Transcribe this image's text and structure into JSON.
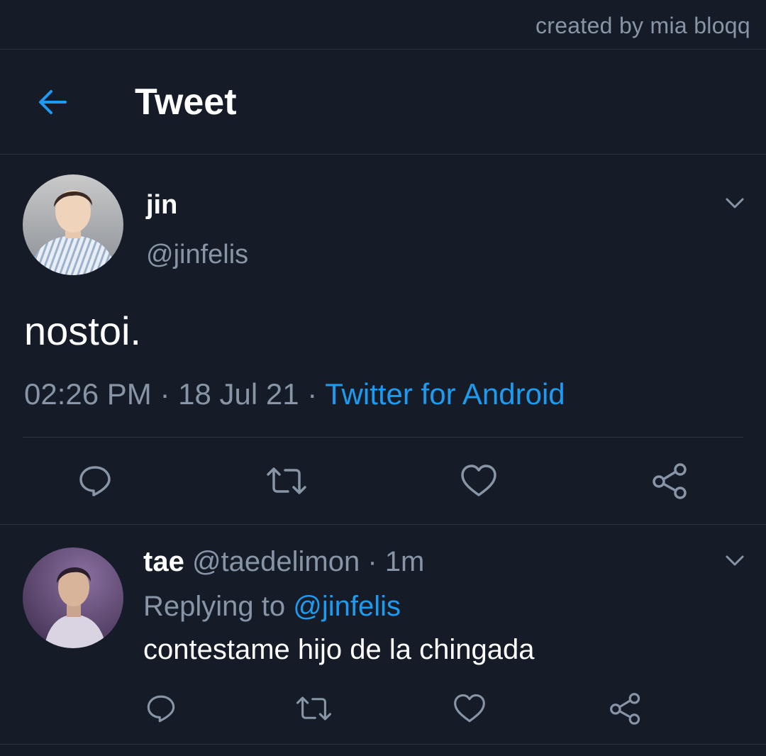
{
  "watermark": "created by mia bloqq",
  "header": {
    "title": "Tweet",
    "back_icon": "arrow-left-icon"
  },
  "tweet": {
    "author_name": "jin",
    "author_handle": "@jinfelis",
    "text": "nostoi.",
    "time": "02:26 PM",
    "separator": "·",
    "date": "18 Jul 21",
    "source": "Twitter for Android",
    "actions": [
      "reply-icon",
      "retweet-icon",
      "like-icon",
      "share-icon"
    ]
  },
  "reply": {
    "author_name": "tae",
    "author_handle": "@taedelimon",
    "separator": "·",
    "age": "1m",
    "replying_prefix": "Replying to",
    "replying_handle": "@jinfelis",
    "text": "contestame hijo de la chingada",
    "actions": [
      "reply-icon",
      "retweet-icon",
      "like-icon",
      "share-icon"
    ]
  },
  "colors": {
    "background": "#151c28",
    "accent": "#1d9bf0",
    "muted": "#8795a6",
    "divider": "#2a3442"
  }
}
